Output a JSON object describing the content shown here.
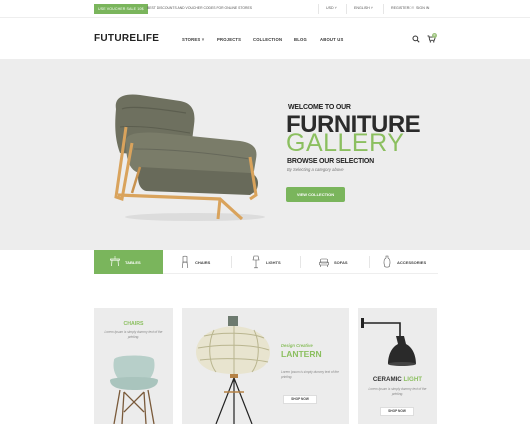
{
  "topbar": {
    "promo_badge": "USE VOUCHER SALE 10$",
    "promo_text": "BEST DISCOUNTS AND VOUCHER CODES FOR ONLINE STORES",
    "currency": "USD",
    "language": "ENGLISH",
    "register": "REGISTER",
    "or": "OR",
    "signin": "SIGN IN"
  },
  "header": {
    "logo": "FUTURELIFE",
    "nav": [
      "STORES",
      "PROJECTS",
      "COLLECTION",
      "BLOG",
      "ABOUT US"
    ],
    "cart_count": "0"
  },
  "hero": {
    "welcome": "WELCOME TO OUR",
    "title_line1": "FURNITURE",
    "title_line2": "GALLERY",
    "browse": "BROWSE OUR SELECTION",
    "subtitle": "By Selecting a category above",
    "button": "VIEW COLLECTION"
  },
  "categories": [
    {
      "label": "TABLES",
      "icon": "table-icon",
      "active": true
    },
    {
      "label": "CHAIRS",
      "icon": "chair-icon",
      "active": false
    },
    {
      "label": "LIGHTS",
      "icon": "light-icon",
      "active": false
    },
    {
      "label": "SOFAS",
      "icon": "sofa-icon",
      "active": false
    },
    {
      "label": "ACCESSORIES",
      "icon": "vase-icon",
      "active": false
    }
  ],
  "banners": {
    "chairs": {
      "title": "CHAIRS",
      "desc": "Lorem Ipsum is simply dummy text of the printing."
    },
    "lantern": {
      "kicker": "Design Creative",
      "title": "LANTERN",
      "desc": "Lorem Ipsum is simply dummy text of the printing.",
      "button": "SHOP NOW"
    },
    "ceramic": {
      "title_main": "CERAMIC",
      "title_accent": "LIGHT",
      "desc": "Lorem Ipsum is simply dummy text of the printing.",
      "button": "SHOP NOW"
    }
  },
  "colors": {
    "accent": "#7ab55c",
    "hero_bg": "#ededed",
    "card_bg": "#ececec"
  }
}
